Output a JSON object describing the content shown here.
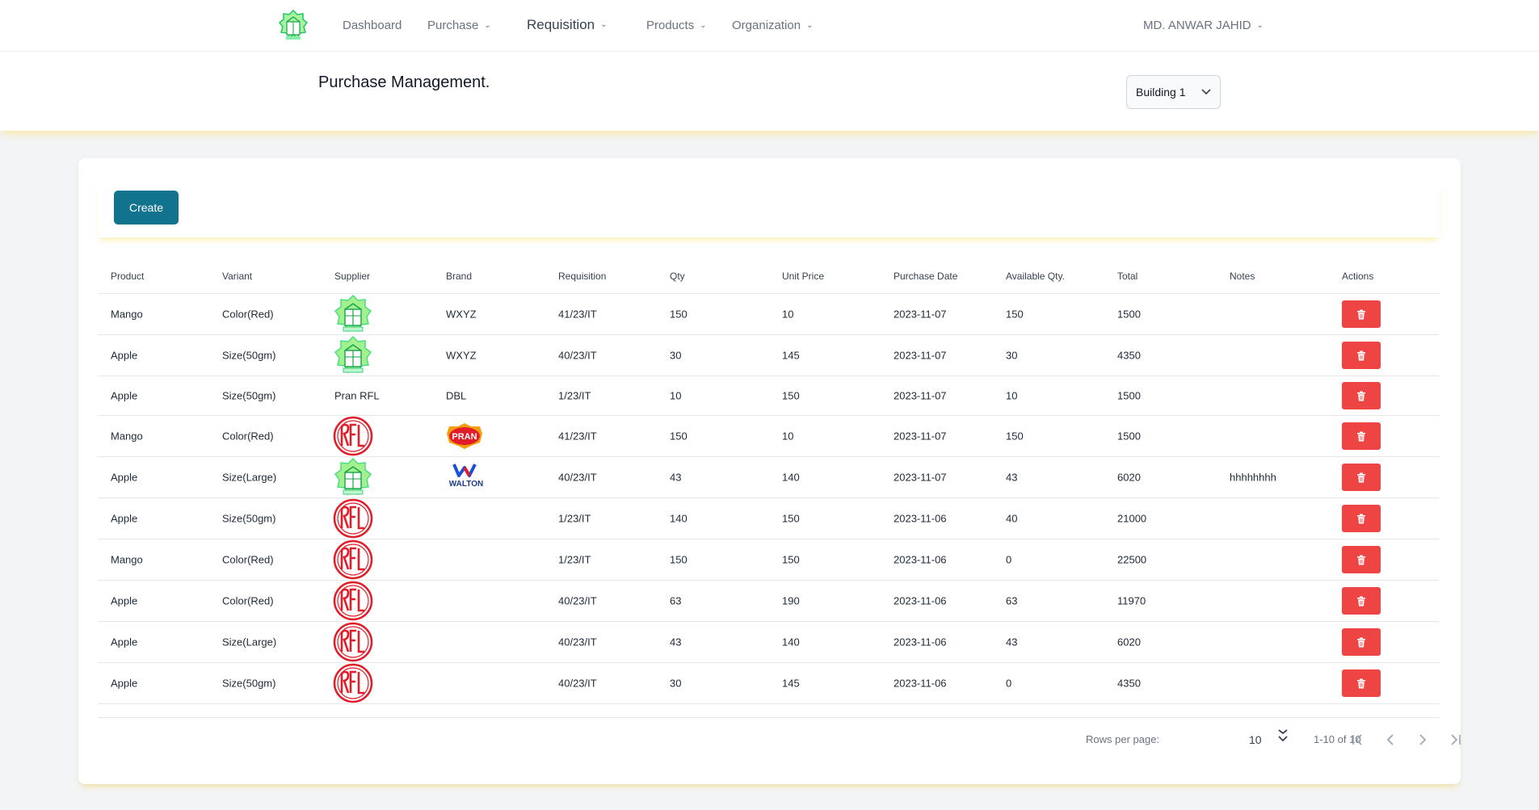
{
  "nav": {
    "dashboard": "Dashboard",
    "purchase": "Purchase",
    "requisition": "Requisition",
    "products": "Products",
    "organization": "Organization",
    "user": "MD. ANWAR JAHID"
  },
  "header": {
    "title": "Purchase Management.",
    "building": "Building 1"
  },
  "toolbar": {
    "create_label": "Create"
  },
  "table": {
    "columns": [
      "Product",
      "Variant",
      "Supplier",
      "Brand",
      "Requisition",
      "Qty",
      "Unit Price",
      "Purchase Date",
      "Available Qty.",
      "Total",
      "Notes",
      "Actions"
    ],
    "rows": [
      {
        "product": "Mango",
        "variant": "Color(Red)",
        "supplier": "green-house-logo",
        "brand": "WXYZ",
        "requisition": "41/23/IT",
        "qty": "150",
        "unit_price": "10",
        "date": "2023-11-07",
        "available": "150",
        "total": "1500",
        "notes": ""
      },
      {
        "product": "Apple",
        "variant": "Size(50gm)",
        "supplier": "green-house-logo",
        "brand": "WXYZ",
        "requisition": "40/23/IT",
        "qty": "30",
        "unit_price": "145",
        "date": "2023-11-07",
        "available": "30",
        "total": "4350",
        "notes": ""
      },
      {
        "product": "Apple",
        "variant": "Size(50gm)",
        "supplier": "Pran RFL",
        "brand": "DBL",
        "requisition": "1/23/IT",
        "qty": "10",
        "unit_price": "150",
        "date": "2023-11-07",
        "available": "10",
        "total": "1500",
        "notes": ""
      },
      {
        "product": "Mango",
        "variant": "Color(Red)",
        "supplier": "rfl-logo",
        "brand": "pran-logo",
        "brand_logo_text": "PRAN",
        "requisition": "41/23/IT",
        "qty": "150",
        "unit_price": "10",
        "date": "2023-11-07",
        "available": "150",
        "total": "1500",
        "notes": ""
      },
      {
        "product": "Apple",
        "variant": "Size(Large)",
        "supplier": "green-house-logo",
        "brand": "walton-logo",
        "brand_logo_text": "WALTON",
        "requisition": "40/23/IT",
        "qty": "43",
        "unit_price": "140",
        "date": "2023-11-07",
        "available": "43",
        "total": "6020",
        "notes": "hhhhhhhh"
      },
      {
        "product": "Apple",
        "variant": "Size(50gm)",
        "supplier": "rfl-logo",
        "brand": "",
        "requisition": "1/23/IT",
        "qty": "140",
        "unit_price": "150",
        "date": "2023-11-06",
        "available": "40",
        "total": "21000",
        "notes": ""
      },
      {
        "product": "Mango",
        "variant": "Color(Red)",
        "supplier": "rfl-logo",
        "brand": "",
        "requisition": "1/23/IT",
        "qty": "150",
        "unit_price": "150",
        "date": "2023-11-06",
        "available": "0",
        "total": "22500",
        "notes": ""
      },
      {
        "product": "Apple",
        "variant": "Color(Red)",
        "supplier": "rfl-logo",
        "brand": "",
        "requisition": "40/23/IT",
        "qty": "63",
        "unit_price": "190",
        "date": "2023-11-06",
        "available": "63",
        "total": "11970",
        "notes": ""
      },
      {
        "product": "Apple",
        "variant": "Size(Large)",
        "supplier": "rfl-logo",
        "brand": "",
        "requisition": "40/23/IT",
        "qty": "43",
        "unit_price": "140",
        "date": "2023-11-06",
        "available": "43",
        "total": "6020",
        "notes": ""
      },
      {
        "product": "Apple",
        "variant": "Size(50gm)",
        "supplier": "rfl-logo",
        "brand": "",
        "requisition": "40/23/IT",
        "qty": "30",
        "unit_price": "145",
        "date": "2023-11-06",
        "available": "0",
        "total": "4350",
        "notes": ""
      }
    ]
  },
  "pagination": {
    "rows_per_page_label": "Rows per page:",
    "rows_per_page": "10",
    "range": "1-10 of 10"
  },
  "colors": {
    "accent": "#12738f",
    "danger": "#ef4444",
    "shadow_glow": "#fae06e"
  }
}
